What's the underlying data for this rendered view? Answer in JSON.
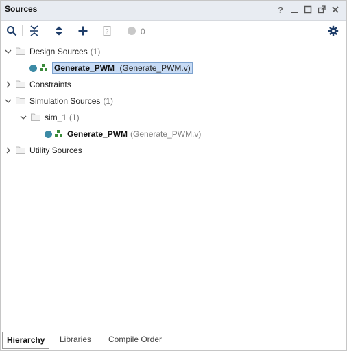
{
  "window": {
    "title": "Sources",
    "buttons": [
      "help",
      "minimize",
      "maximize",
      "float",
      "close"
    ]
  },
  "toolbar": {
    "items": [
      {
        "name": "search-icon"
      },
      {
        "name": "collapse-all-icon"
      },
      {
        "name": "expand-all-icon"
      },
      {
        "name": "add-icon"
      },
      {
        "name": "properties-icon"
      },
      {
        "name": "status-circle-icon"
      }
    ],
    "count": "0",
    "settings_icon": "gear-icon"
  },
  "tree": {
    "design_sources": {
      "label": "Design Sources",
      "count": "(1)"
    },
    "design_top": {
      "name": "Generate_PWM",
      "file": "(Generate_PWM.v)"
    },
    "constraints": {
      "label": "Constraints"
    },
    "simulation_sources": {
      "label": "Simulation Sources",
      "count": "(1)"
    },
    "sim_1": {
      "label": "sim_1",
      "count": "(1)"
    },
    "sim_top": {
      "name": "Generate_PWM",
      "file": "(Generate_PWM.v)"
    },
    "utility_sources": {
      "label": "Utility Sources"
    }
  },
  "tabs": {
    "hierarchy": "Hierarchy",
    "libraries": "Libraries",
    "compile_order": "Compile Order"
  },
  "colors": {
    "titlebar": "#e8ecf2",
    "accent": "#1a5fa8",
    "selection": "#c7dbf5",
    "dot": "#3c8aa5",
    "hier_green": "#3a8a3a"
  }
}
